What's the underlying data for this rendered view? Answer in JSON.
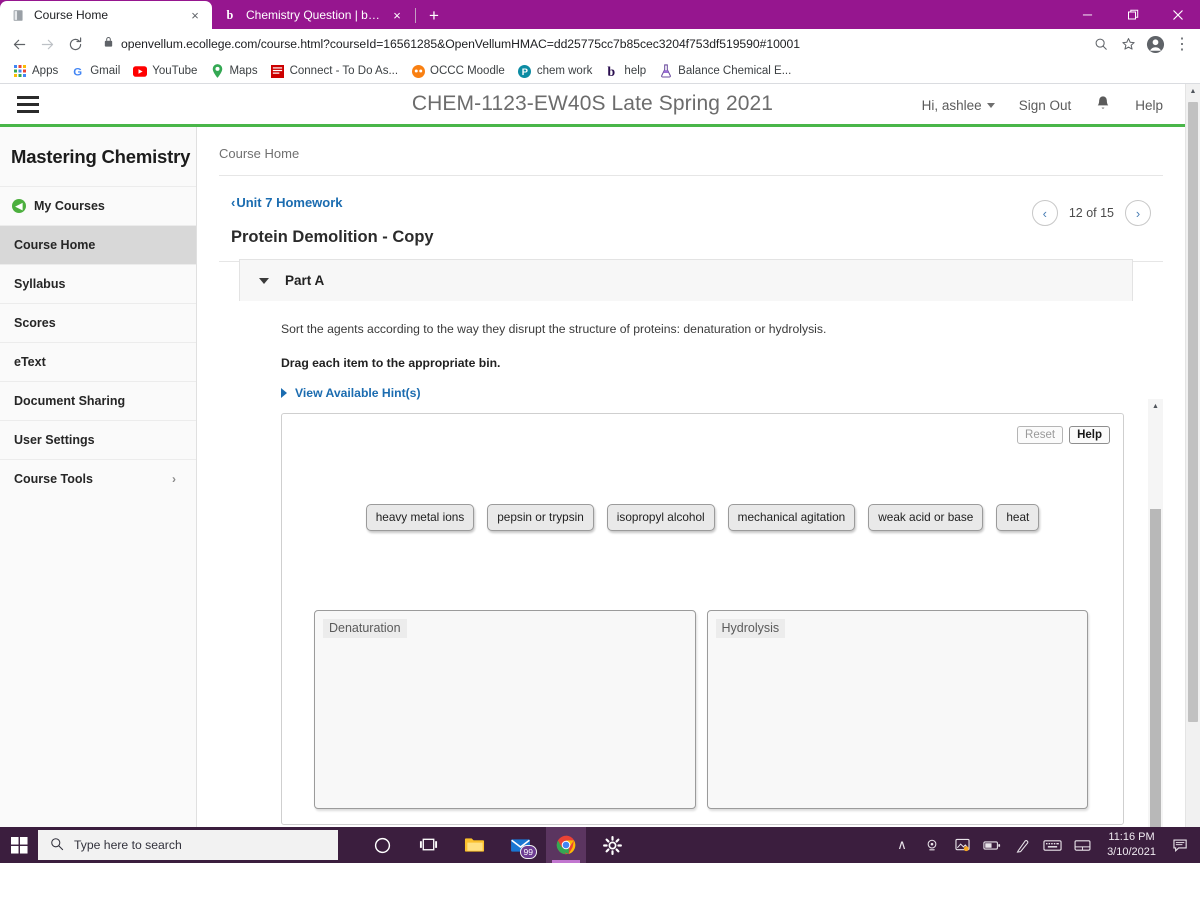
{
  "browser": {
    "tabs": [
      {
        "title": "Course Home",
        "favicon": "book-icon",
        "active": true,
        "close_label": "×"
      },
      {
        "title": "Chemistry Question | bartleby",
        "favicon": "bartleby-b-icon",
        "active": false,
        "close_label": "×"
      }
    ],
    "new_tab_label": "+",
    "window_controls": {
      "minimize": "—",
      "maximize": "❐",
      "close": "✕"
    },
    "toolbar": {
      "back_label": "←",
      "forward_label": "→",
      "reload_label": "⟳",
      "lock_icon": "padlock-icon",
      "url": "openvellum.ecollege.com/course.html?courseId=16561285&OpenVellumHMAC=dd25775cc7b85cec3204f753df519590#10001",
      "zoom_icon": "⊕",
      "star_icon": "☆",
      "profile_icon": "user-avatar-icon",
      "menu_icon": "⋮"
    },
    "bookmarks": [
      {
        "label": "Apps",
        "icon": "apps-grid-icon"
      },
      {
        "label": "Gmail",
        "icon": "gmail-icon"
      },
      {
        "label": "YouTube",
        "icon": "youtube-icon"
      },
      {
        "label": "Maps",
        "icon": "maps-pin-icon"
      },
      {
        "label": "Connect - To Do As...",
        "icon": "connect-icon"
      },
      {
        "label": "OCCC Moodle",
        "icon": "moodle-icon"
      },
      {
        "label": "chem work",
        "icon": "pearson-p-icon"
      },
      {
        "label": "help",
        "icon": "bartleby-b-icon"
      },
      {
        "label": "Balance Chemical E...",
        "icon": "flask-icon"
      }
    ]
  },
  "site_header": {
    "menu_icon": "hamburger-menu-icon",
    "course_title": "CHEM-1123-EW40S Late Spring 2021",
    "greeting": "Hi, ashlee",
    "sign_out": "Sign Out",
    "notifications_icon": "bell-icon",
    "help": "Help",
    "accent_color": "#49b649"
  },
  "sidebar": {
    "brand": "Mastering Chemistry",
    "items": [
      {
        "label": "My Courses",
        "icon": "back-arrow-circle-icon",
        "active": false
      },
      {
        "label": "Course Home",
        "icon": "",
        "active": true
      },
      {
        "label": "Syllabus",
        "icon": "",
        "active": false
      },
      {
        "label": "Scores",
        "icon": "",
        "active": false
      },
      {
        "label": "eText",
        "icon": "",
        "active": false
      },
      {
        "label": "Document Sharing",
        "icon": "",
        "active": false
      },
      {
        "label": "User Settings",
        "icon": "",
        "active": false
      },
      {
        "label": "Course Tools",
        "icon": "",
        "active": false,
        "chevron": "›"
      }
    ]
  },
  "content": {
    "breadcrumb": "Course Home",
    "back_link": "Unit 7 Homework",
    "back_caret": "‹",
    "assignment_title": "Protein Demolition - Copy",
    "pager": {
      "prev": "‹",
      "next": "›",
      "label": "12 of 15"
    }
  },
  "part": {
    "label": "Part A",
    "question": "Sort the agents according to the way they disrupt the structure of proteins: denaturation or hydrolysis.",
    "instruction": "Drag each item to the appropriate bin.",
    "hint_link": "View Available Hint(s)",
    "tools": {
      "reset": "Reset",
      "help": "Help"
    },
    "draggables": [
      "heavy metal ions",
      "pepsin or trypsin",
      "isopropyl alcohol",
      "mechanical agitation",
      "weak acid or base",
      "heat"
    ],
    "bins": [
      {
        "label": "Denaturation",
        "items": []
      },
      {
        "label": "Hydrolysis",
        "items": []
      }
    ]
  },
  "taskbar": {
    "start_icon": "windows-start-icon",
    "search_placeholder": "Type here to search",
    "search_icon": "search-icon",
    "apps": [
      {
        "name": "cortana-icon",
        "glyph": "○"
      },
      {
        "name": "task-view-icon",
        "glyph": "⧉"
      },
      {
        "name": "file-explorer-icon",
        "glyph": "🗀"
      },
      {
        "name": "mail-icon",
        "glyph": "✉",
        "badge": "99"
      },
      {
        "name": "chrome-icon",
        "glyph": "◉"
      },
      {
        "name": "settings-gear-icon",
        "glyph": "⚙"
      }
    ],
    "tray": [
      {
        "name": "show-hidden-icons-chevron",
        "glyph": "∧"
      },
      {
        "name": "webcam-icon",
        "glyph": "⚇"
      },
      {
        "name": "image-tray-icon",
        "glyph": "❑"
      },
      {
        "name": "battery-icon",
        "glyph": "▃"
      },
      {
        "name": "pen-icon",
        "glyph": "✐"
      },
      {
        "name": "keyboard-icon",
        "glyph": "⌨"
      },
      {
        "name": "touchpad-icon",
        "glyph": "▭"
      }
    ],
    "time": "11:16 PM",
    "date": "3/10/2021",
    "action_center_icon": "notification-center-icon"
  }
}
